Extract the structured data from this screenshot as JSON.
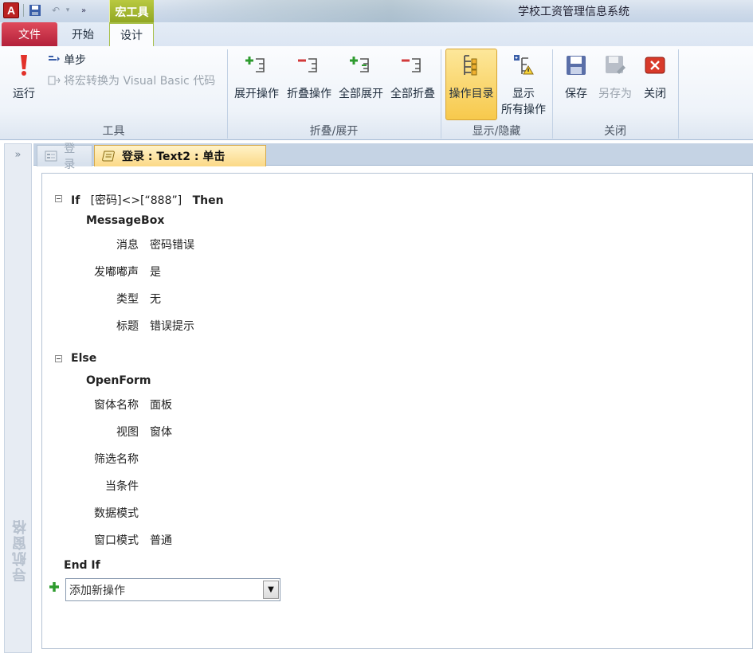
{
  "window": {
    "title": "学校工资管理信息系统",
    "app_icon_letter": "A",
    "macro_tools_label": "宏工具"
  },
  "ribbon": {
    "tabs": [
      {
        "label": "文件"
      },
      {
        "label": "开始"
      },
      {
        "label": "设计"
      }
    ],
    "groups": {
      "tools": {
        "label": "工具",
        "run_label": "运行",
        "single_step_label": "单步",
        "convert_label": "将宏转换为 Visual Basic 代码"
      },
      "collapse_expand": {
        "label": "折叠/展开",
        "expand_action": "展开操作",
        "collapse_action": "折叠操作",
        "expand_all": "全部展开",
        "collapse_all": "全部折叠"
      },
      "show_hide": {
        "label": "显示/隐藏",
        "action_catalog": "操作目录",
        "show_all_line1": "显示",
        "show_all_line2": "所有操作"
      },
      "close": {
        "label": "关闭",
        "save": "保存",
        "save_as": "另存为",
        "close": "关闭"
      }
    }
  },
  "nav_pane": {
    "toggle": "»",
    "title": "导航窗格"
  },
  "doc_tabs": [
    {
      "label": "登录",
      "active": false
    },
    {
      "label": "登录 : Text2 : 单击",
      "active": true
    }
  ],
  "macro": {
    "if_keyword": "If",
    "condition": "[密码]<>[“888”]",
    "then_keyword": "Then",
    "message_box": {
      "name": "MessageBox",
      "args": [
        {
          "label": "消息",
          "value": "密码错误"
        },
        {
          "label": "发嘟嘟声",
          "value": "是"
        },
        {
          "label": "类型",
          "value": "无"
        },
        {
          "label": "标题",
          "value": "错误提示"
        }
      ]
    },
    "else_keyword": "Else",
    "open_form": {
      "name": "OpenForm",
      "args": [
        {
          "label": "窗体名称",
          "value": "面板"
        },
        {
          "label": "视图",
          "value": "窗体"
        },
        {
          "label": "筛选名称",
          "value": ""
        },
        {
          "label": "当条件",
          "value": ""
        },
        {
          "label": "数据模式",
          "value": ""
        },
        {
          "label": "窗口模式",
          "value": "普通"
        }
      ]
    },
    "end_if": "End If",
    "add_action_placeholder": "添加新操作"
  },
  "colors": {
    "file_tab": "#c0283f",
    "macro_tools": "#9db030",
    "active_doc_tab": "#fbd986",
    "active_catalog": "#f7c94c"
  }
}
